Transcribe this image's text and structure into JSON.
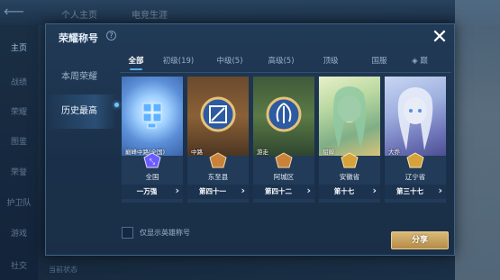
{
  "background": {
    "top_tabs": [
      "个人主页",
      "电竞生涯"
    ],
    "sidebar": [
      "主页",
      "战绩",
      "荣耀",
      "图鉴",
      "荣誉",
      "护卫队",
      "游戏",
      "社交"
    ],
    "bottom_text": "当前状态"
  },
  "dialog": {
    "title": "荣耀称号",
    "help_glyph": "?",
    "close_glyph": "✕"
  },
  "left_nav": [
    {
      "label": "本周荣耀",
      "active": false
    },
    {
      "label": "历史最高",
      "active": true
    }
  ],
  "tabs": [
    {
      "label": "全部",
      "active": true
    },
    {
      "label": "初级(19)",
      "active": false
    },
    {
      "label": "中级(5)",
      "active": false
    },
    {
      "label": "高级(5)",
      "active": false
    },
    {
      "label": "顶级",
      "active": false
    },
    {
      "label": "国服",
      "active": false
    },
    {
      "label": "◈ 巅",
      "active": false
    }
  ],
  "cards": [
    {
      "hero_label": "巅峰中路(全国)",
      "region": "全国",
      "rank": "一万强",
      "theme": "blue",
      "emblem_color": "#6a5cff"
    },
    {
      "hero_label": "中路",
      "region": "东至县",
      "rank": "第四十一",
      "theme": "brown",
      "emblem_color": "#c9823a"
    },
    {
      "hero_label": "游走",
      "region": "阿城区",
      "rank": "第四十二",
      "theme": "green",
      "emblem_color": "#c9823a"
    },
    {
      "hero_label": "貂蝉",
      "region": "安徽省",
      "rank": "第十七",
      "theme": "gold",
      "emblem_color": "#d6a23a"
    },
    {
      "hero_label": "大乔",
      "region": "辽宁省",
      "rank": "第三十七",
      "theme": "purple",
      "emblem_color": "#d6a23a"
    }
  ],
  "only_hero_label": "仅显示英雄称号",
  "share_label": "分享",
  "colors": {
    "accent_blue": "#4fb0ff",
    "share_gold": "#c9a25c"
  }
}
